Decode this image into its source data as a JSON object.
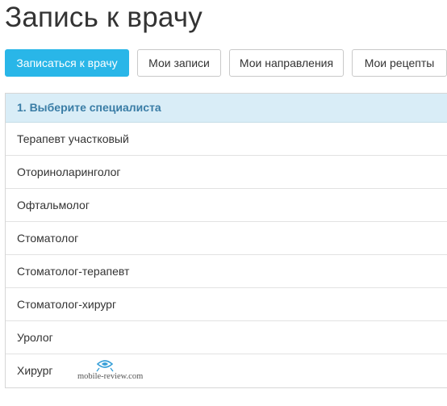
{
  "page": {
    "title": "Запись к врачу"
  },
  "tabs": [
    {
      "label": "Записаться к врачу",
      "active": true
    },
    {
      "label": "Мои записи",
      "active": false
    },
    {
      "label": "Мои направления",
      "active": false
    },
    {
      "label": "Мои рецепты",
      "active": false
    }
  ],
  "specialists": {
    "header": "1. Выберите специалиста",
    "items": [
      "Терапевт участковый",
      "Оториноларинголог",
      "Офтальмолог",
      "Стоматолог",
      "Стоматолог-терапевт",
      "Стоматолог-хирург",
      "Уролог",
      "Хирург"
    ]
  },
  "watermark": {
    "text": "mobile-review.com",
    "logo_icon": "mobile-review-logo-icon"
  },
  "colors": {
    "accent": "#29b6e8",
    "header_bg": "#d9edf7",
    "header_text": "#3a7da6"
  }
}
